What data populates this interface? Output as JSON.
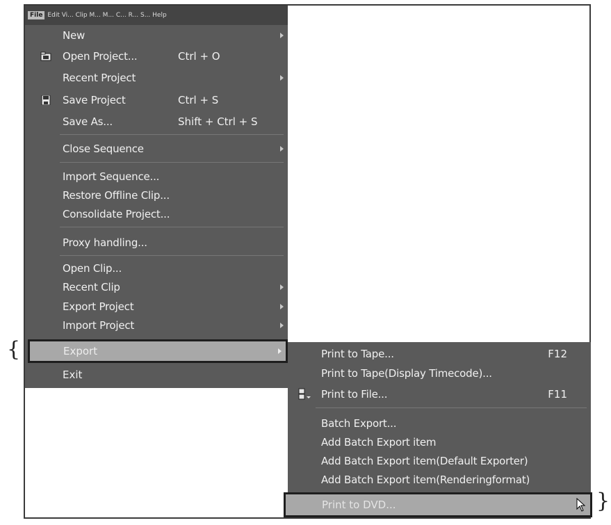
{
  "menubar": {
    "file_label": "File",
    "rest_label": "Edit Vi... Clip M... M... C... R... S... Help"
  },
  "main_menu": {
    "items": [
      {
        "label": "New",
        "shortcut": "",
        "submenu": true,
        "icon": ""
      },
      {
        "label": "Open Project...",
        "shortcut": "Ctrl + O",
        "submenu": false,
        "icon": "open-folder-icon"
      },
      {
        "label": "Recent Project",
        "shortcut": "",
        "submenu": true,
        "icon": ""
      },
      {
        "label": "Save Project",
        "shortcut": "Ctrl + S",
        "submenu": false,
        "icon": "floppy-disk-icon"
      },
      {
        "label": "Save As...",
        "shortcut": "Shift + Ctrl + S",
        "submenu": false,
        "icon": ""
      },
      {
        "label": "Close Sequence",
        "shortcut": "",
        "submenu": true,
        "icon": ""
      },
      {
        "label": "Import Sequence...",
        "shortcut": "",
        "submenu": false,
        "icon": ""
      },
      {
        "label": "Restore Offline Clip...",
        "shortcut": "",
        "submenu": false,
        "icon": ""
      },
      {
        "label": "Consolidate Project...",
        "shortcut": "",
        "submenu": false,
        "icon": ""
      },
      {
        "label": "Proxy handling...",
        "shortcut": "",
        "submenu": false,
        "icon": ""
      },
      {
        "label": "Open Clip...",
        "shortcut": "",
        "submenu": false,
        "icon": ""
      },
      {
        "label": "Recent Clip",
        "shortcut": "",
        "submenu": true,
        "icon": ""
      },
      {
        "label": "Export Project",
        "shortcut": "",
        "submenu": true,
        "icon": ""
      },
      {
        "label": "Import Project",
        "shortcut": "",
        "submenu": true,
        "icon": ""
      }
    ],
    "highlighted_label": "Export",
    "exit_label": "Exit"
  },
  "sub_menu": {
    "items": [
      {
        "label": "Print to Tape...",
        "shortcut": "F12",
        "icon": ""
      },
      {
        "label": "Print to Tape(Display Timecode)...",
        "shortcut": "",
        "icon": ""
      },
      {
        "label": "Print to File...",
        "shortcut": "F11",
        "icon": "print-to-file-icon"
      },
      {
        "label": "Batch Export...",
        "shortcut": "",
        "icon": ""
      },
      {
        "label": "Add Batch Export item",
        "shortcut": "",
        "icon": ""
      },
      {
        "label": "Add Batch Export item(Default Exporter)",
        "shortcut": "",
        "icon": ""
      },
      {
        "label": "Add Batch Export item(Renderingformat)",
        "shortcut": "",
        "icon": ""
      }
    ],
    "highlighted_label": "Print to DVD..."
  },
  "colors": {
    "menu_bg": "#5a5a5a",
    "highlight_bg": "#a8a8a8",
    "text": "#f0f0f0"
  }
}
